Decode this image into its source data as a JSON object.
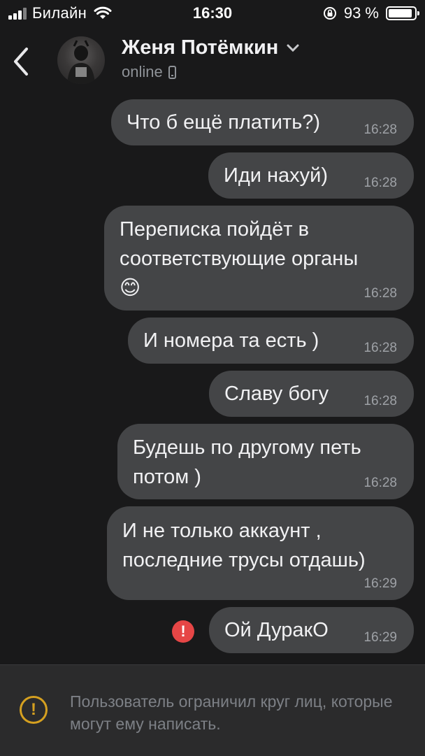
{
  "status_bar": {
    "carrier": "Билайн",
    "time": "16:30",
    "battery_text": "93 %",
    "battery_level": 0.93
  },
  "header": {
    "contact_name": "Женя Потёмкин",
    "status": "online"
  },
  "messages": [
    {
      "text": "Что б ещё платить?)",
      "time": "16:28"
    },
    {
      "text": "Иди нахуй)",
      "time": "16:28"
    },
    {
      "text": "Переписка пойдёт в\nсоответствующие органы\n😊",
      "time": "16:28"
    },
    {
      "text": "И номера та есть )",
      "time": "16:28"
    },
    {
      "text": "Славу богу",
      "time": "16:28"
    },
    {
      "text": "Будешь по другому петь\nпотом )",
      "time": "16:28"
    },
    {
      "text": "И не только аккаунт ,\nпоследние трусы отдашь)",
      "time": "16:29"
    },
    {
      "text": "Ой ДуракО",
      "time": "16:29",
      "failed": true
    }
  ],
  "footer": {
    "notice": "Пользователь ограничил круг лиц, которые могут ему написать."
  },
  "colors": {
    "background": "#19191a",
    "bubble": "#444547",
    "error": "#e64646",
    "warning": "#d5a020"
  }
}
